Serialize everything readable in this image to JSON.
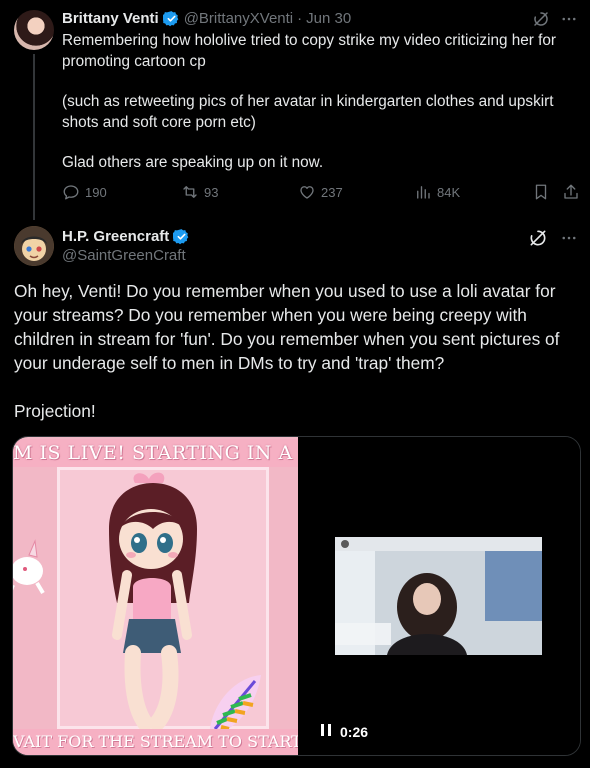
{
  "tweet1": {
    "name": "Brittany Venti",
    "handle": "@BrittanyXVenti",
    "date": "Jun 30",
    "paragraphs": [
      "Remembering how hololive tried to copy strike my video criticizing her for promoting cartoon cp",
      "(such as retweeting pics of her avatar in kindergarten clothes and upskirt shots and soft core porn etc)",
      "Glad others are speaking up on it now."
    ],
    "stats": {
      "replies": "190",
      "reposts": "93",
      "likes": "237",
      "views": "84K"
    }
  },
  "tweet2": {
    "name": "H.P. Greencraft",
    "handle": "@SaintGreenCraft",
    "paragraphs": [
      "Oh hey, Venti! Do you remember when you used to use a loli avatar for your streams? Do you remember when you were being creepy with children in stream for 'fun'. Do you remember when you sent pictures of your underage self to men in DMs to try and 'trap' them?",
      "Projection!"
    ],
    "video": {
      "banner_top": "M IS LIVE! STARTING IN A FE",
      "banner_bottom": "VAIT FOR THE STREAM TO START II",
      "duration": "0:26"
    }
  },
  "colors": {
    "background": "#000000",
    "text": "#e7e9ea",
    "muted": "#71767b",
    "verified": "#1d9bf0",
    "banner_pink": "#f6b0c3"
  }
}
